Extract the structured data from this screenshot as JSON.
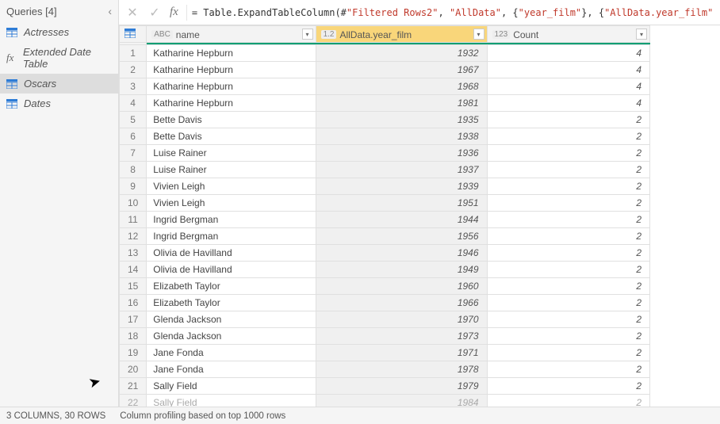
{
  "sidebar": {
    "title": "Queries [4]",
    "items": [
      {
        "label": "Actresses",
        "icon": "table"
      },
      {
        "label": "Extended Date Table",
        "icon": "fx"
      },
      {
        "label": "Oscars",
        "icon": "table",
        "selected": true
      },
      {
        "label": "Dates",
        "icon": "table"
      }
    ]
  },
  "formula": {
    "parts": {
      "eq": "= ",
      "fn": "Table.ExpandTableColumn(#",
      "s1": "\"Filtered Rows2\"",
      "c1": ", ",
      "s2": "\"AllData\"",
      "c2": ", {",
      "s3": "\"year_film\"",
      "c3": "}, {",
      "s4": "\"AllData.year_film\"",
      "c4": "})"
    }
  },
  "columns": {
    "name": {
      "type": "ABC",
      "label": "name"
    },
    "year": {
      "type": "1.2",
      "label": "AllData.year_film"
    },
    "count": {
      "type": "123",
      "label": "Count"
    }
  },
  "chart_data": {
    "type": "table",
    "columns": [
      "name",
      "AllData.year_film",
      "Count"
    ],
    "rows": [
      {
        "n": 1,
        "name": "Katharine Hepburn",
        "year": 1932,
        "count": 4
      },
      {
        "n": 2,
        "name": "Katharine Hepburn",
        "year": 1967,
        "count": 4
      },
      {
        "n": 3,
        "name": "Katharine Hepburn",
        "year": 1968,
        "count": 4
      },
      {
        "n": 4,
        "name": "Katharine Hepburn",
        "year": 1981,
        "count": 4
      },
      {
        "n": 5,
        "name": "Bette Davis",
        "year": 1935,
        "count": 2
      },
      {
        "n": 6,
        "name": "Bette Davis",
        "year": 1938,
        "count": 2
      },
      {
        "n": 7,
        "name": "Luise Rainer",
        "year": 1936,
        "count": 2
      },
      {
        "n": 8,
        "name": "Luise Rainer",
        "year": 1937,
        "count": 2
      },
      {
        "n": 9,
        "name": "Vivien Leigh",
        "year": 1939,
        "count": 2
      },
      {
        "n": 10,
        "name": "Vivien Leigh",
        "year": 1951,
        "count": 2
      },
      {
        "n": 11,
        "name": "Ingrid Bergman",
        "year": 1944,
        "count": 2
      },
      {
        "n": 12,
        "name": "Ingrid Bergman",
        "year": 1956,
        "count": 2
      },
      {
        "n": 13,
        "name": "Olivia de Havilland",
        "year": 1946,
        "count": 2
      },
      {
        "n": 14,
        "name": "Olivia de Havilland",
        "year": 1949,
        "count": 2
      },
      {
        "n": 15,
        "name": "Elizabeth Taylor",
        "year": 1960,
        "count": 2
      },
      {
        "n": 16,
        "name": "Elizabeth Taylor",
        "year": 1966,
        "count": 2
      },
      {
        "n": 17,
        "name": "Glenda Jackson",
        "year": 1970,
        "count": 2
      },
      {
        "n": 18,
        "name": "Glenda Jackson",
        "year": 1973,
        "count": 2
      },
      {
        "n": 19,
        "name": "Jane Fonda",
        "year": 1971,
        "count": 2
      },
      {
        "n": 20,
        "name": "Jane Fonda",
        "year": 1978,
        "count": 2
      },
      {
        "n": 21,
        "name": "Sally Field",
        "year": 1979,
        "count": 2
      },
      {
        "n": 22,
        "name": "Sally Field",
        "year": 1984,
        "count": 2
      }
    ]
  },
  "status": {
    "cols_rows": "3 COLUMNS, 30 ROWS",
    "profiling": "Column profiling based on top 1000 rows"
  }
}
